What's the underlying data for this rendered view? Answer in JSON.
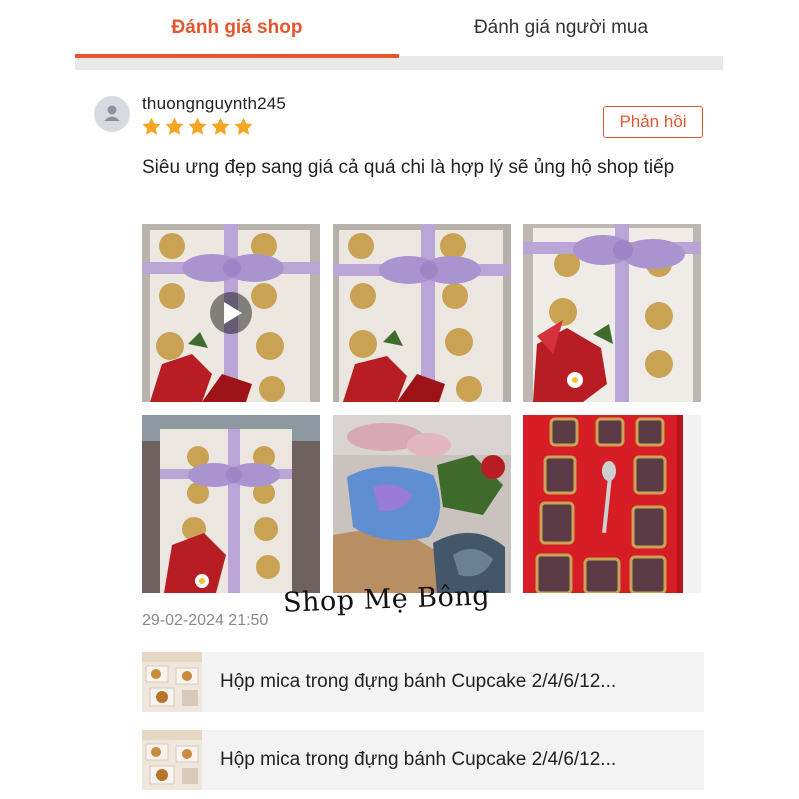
{
  "tabs": [
    {
      "label": "Đánh giá shop",
      "active": true
    },
    {
      "label": "Đánh giá người mua",
      "active": false
    }
  ],
  "review": {
    "username": "thuongnguynth245",
    "rating": 5,
    "reply_label": "Phản hồi",
    "text": "Siêu ưng đẹp sang giá cả quá chi là hợp lý sẽ ủng hộ shop tiếp",
    "timestamp": "29-02-2024 21:50",
    "photos": [
      {
        "kind": "video",
        "icon": "play-icon"
      },
      {
        "kind": "image"
      },
      {
        "kind": "image"
      },
      {
        "kind": "image"
      },
      {
        "kind": "image"
      },
      {
        "kind": "image"
      }
    ]
  },
  "watermark": "Shop Mẹ Bông",
  "products": [
    {
      "name": "Hộp mica trong đựng bánh Cupcake 2/4/6/12..."
    },
    {
      "name": "Hộp mica trong đựng bánh Cupcake 2/4/6/12..."
    }
  ],
  "colors": {
    "accent": "#e4572e",
    "star": "#f5a623",
    "divider": "#e9e9e9",
    "product_bg": "#f3f3f3"
  }
}
